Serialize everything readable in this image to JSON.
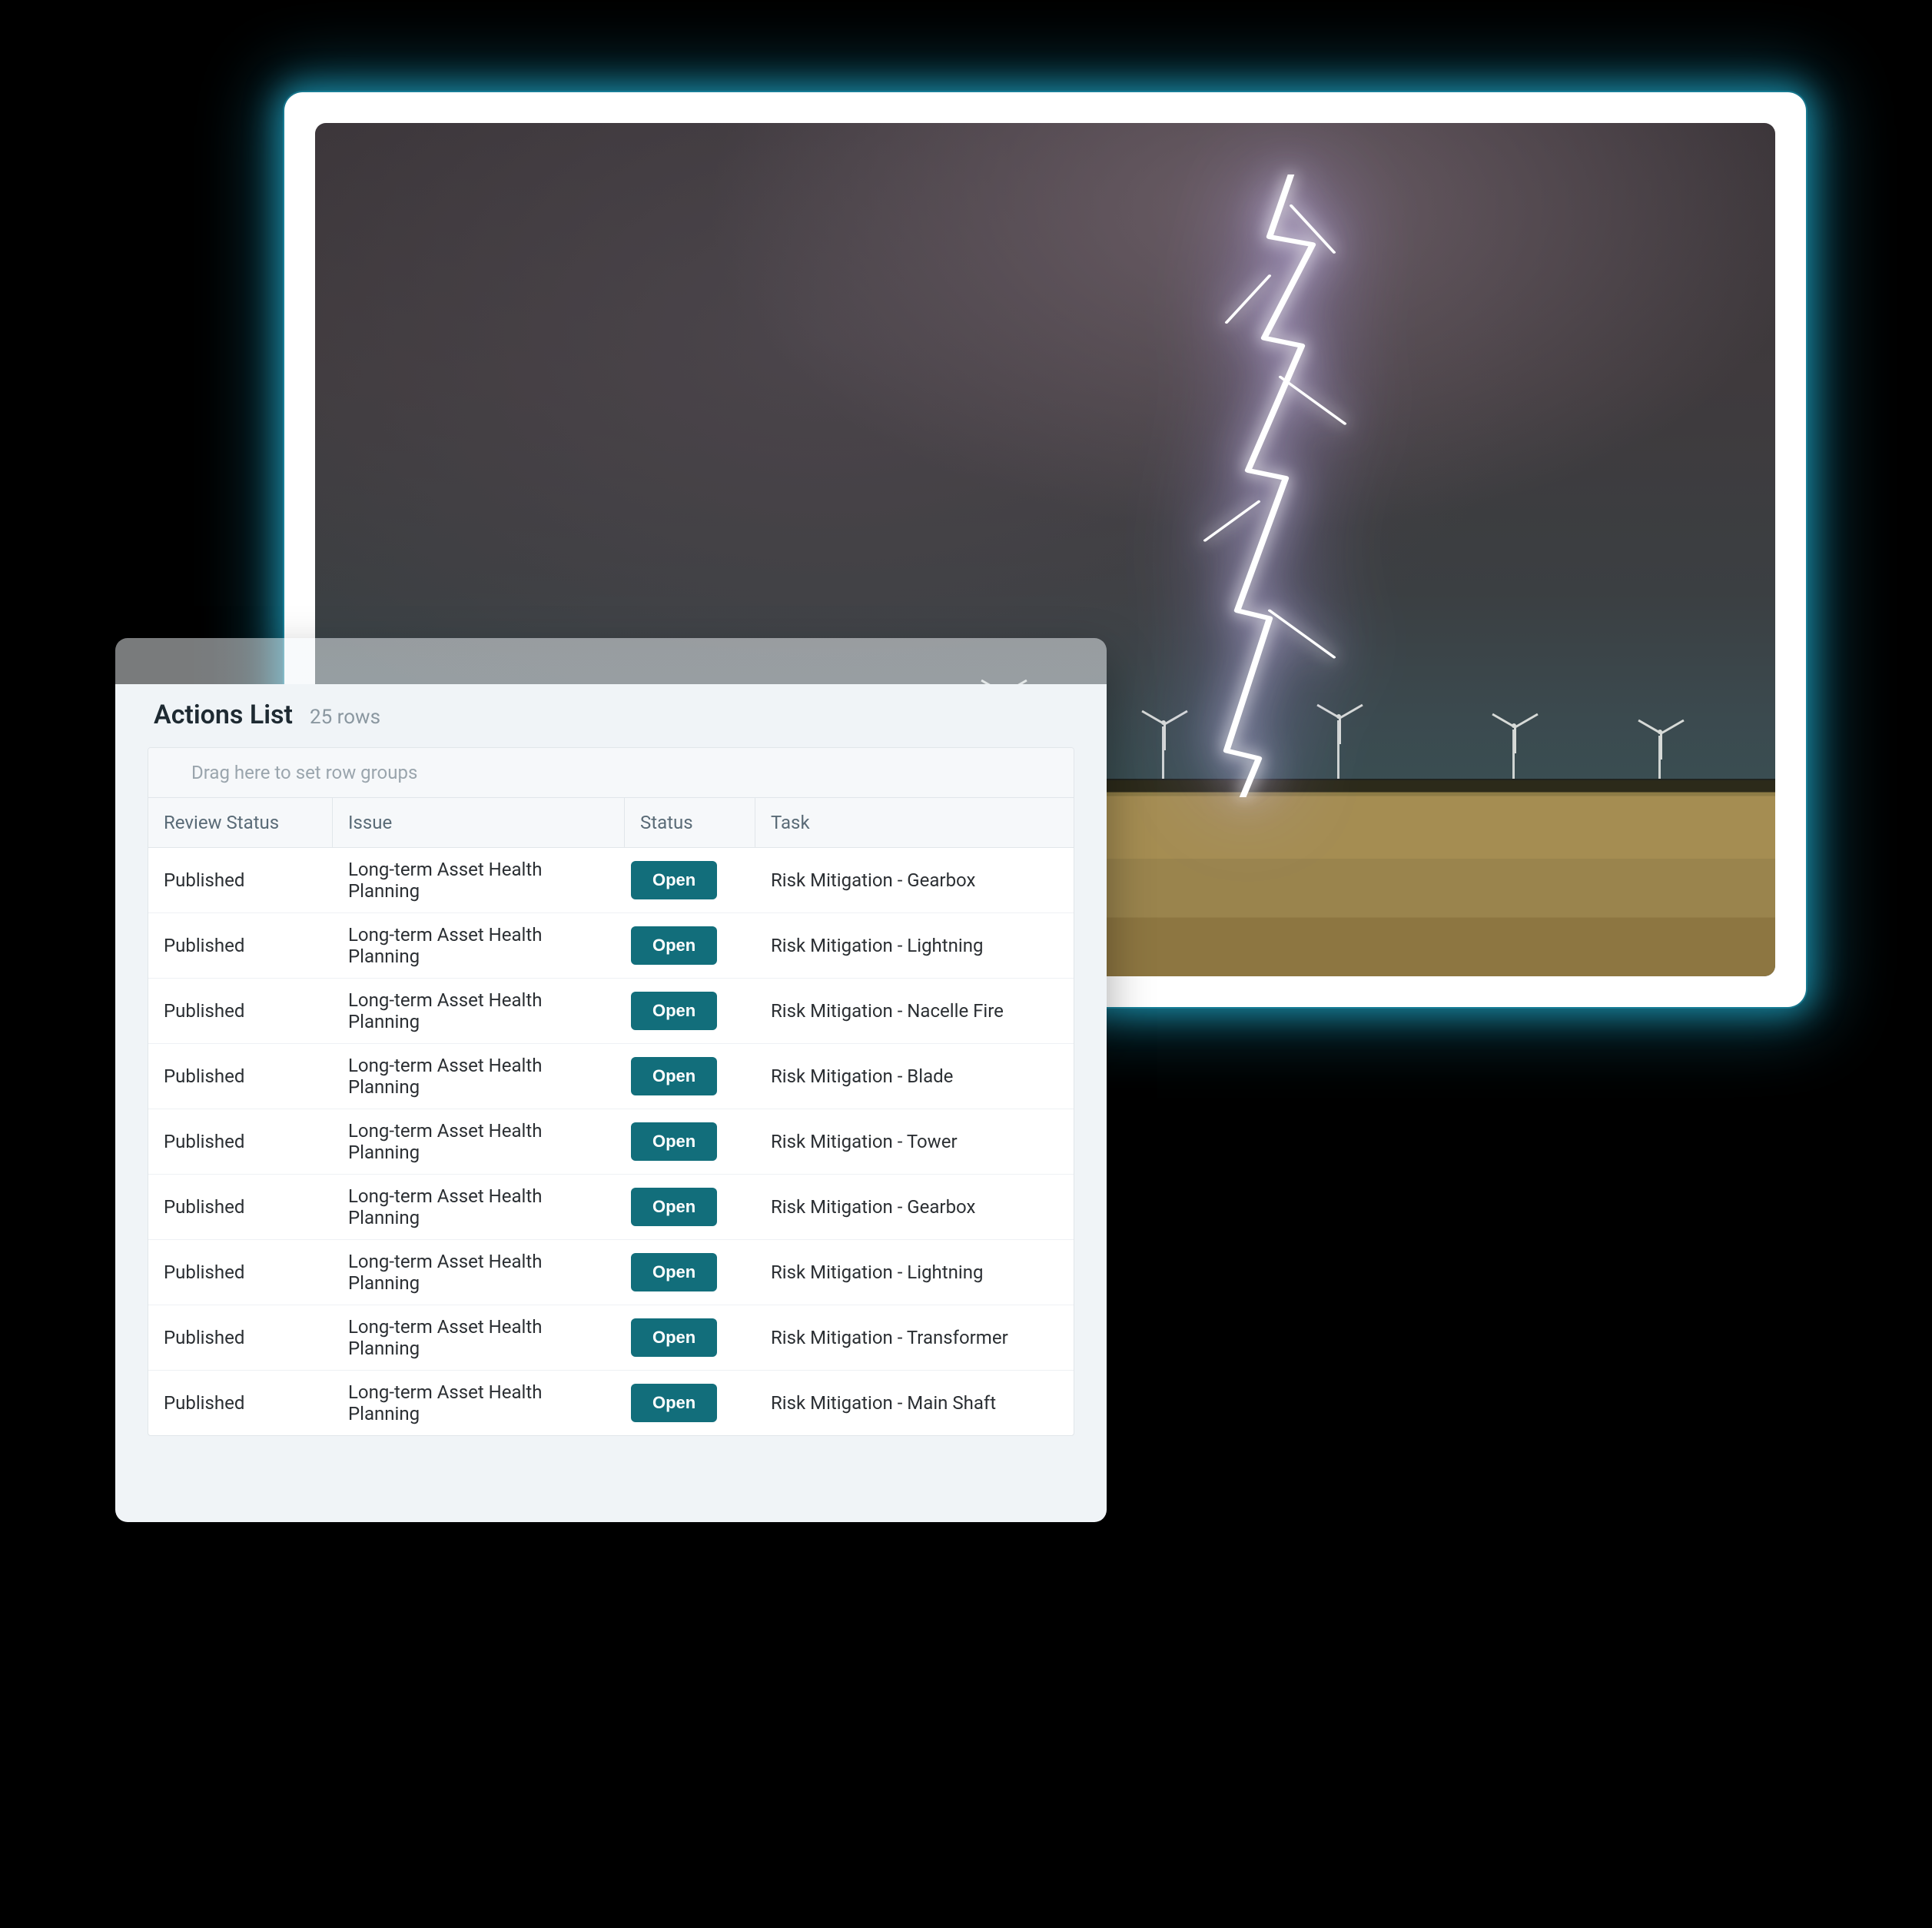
{
  "panel": {
    "title": "Actions List",
    "row_count_label": "25 rows",
    "drag_hint": "Drag here to set row groups",
    "columns": [
      "Review Status",
      "Issue",
      "Status",
      "Task"
    ],
    "rows": [
      {
        "review": "Published",
        "issue": "Long-term Asset Health Planning",
        "status": "Open",
        "task": "Risk Mitigation - Gearbox"
      },
      {
        "review": "Published",
        "issue": "Long-term Asset Health Planning",
        "status": "Open",
        "task": "Risk Mitigation - Lightning"
      },
      {
        "review": "Published",
        "issue": "Long-term Asset Health Planning",
        "status": "Open",
        "task": "Risk Mitigation - Nacelle Fire"
      },
      {
        "review": "Published",
        "issue": "Long-term Asset Health Planning",
        "status": "Open",
        "task": "Risk Mitigation - Blade"
      },
      {
        "review": "Published",
        "issue": "Long-term Asset Health Planning",
        "status": "Open",
        "task": "Risk Mitigation - Tower"
      },
      {
        "review": "Published",
        "issue": "Long-term Asset Health Planning",
        "status": "Open",
        "task": "Risk Mitigation - Gearbox"
      },
      {
        "review": "Published",
        "issue": "Long-term Asset Health Planning",
        "status": "Open",
        "task": "Risk Mitigation - Lightning"
      },
      {
        "review": "Published",
        "issue": "Long-term Asset Health Planning",
        "status": "Open",
        "task": "Risk Mitigation - Transformer"
      },
      {
        "review": "Published",
        "issue": "Long-term Asset Health Planning",
        "status": "Open",
        "task": "Risk Mitigation - Main Shaft"
      }
    ]
  },
  "image": {
    "alt": "Lightning strike over a wind farm and wheat field at dusk"
  },
  "colors": {
    "accent": "#126e7b",
    "glow": "#25c4eb"
  }
}
